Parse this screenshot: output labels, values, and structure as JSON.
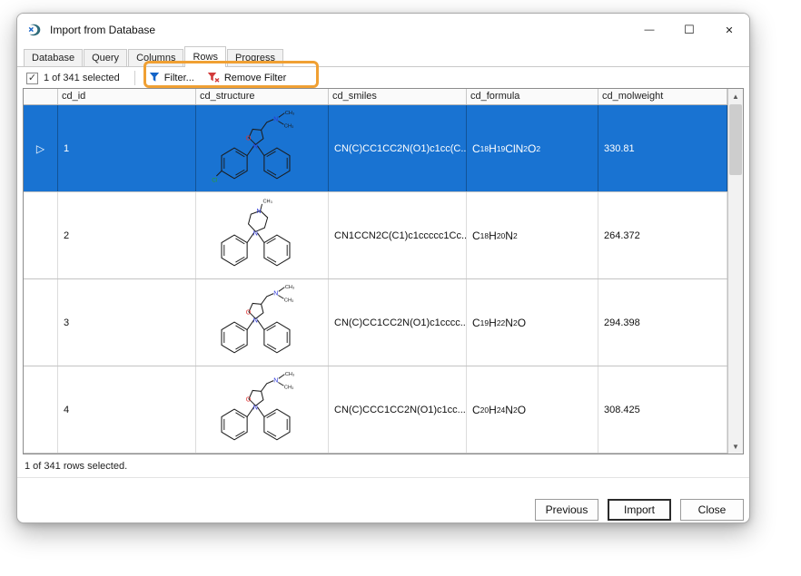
{
  "window": {
    "title": "Import from Database",
    "controls": [
      {
        "name": "minimize",
        "glyph": "—"
      },
      {
        "name": "maximize",
        "glyph": "☐"
      },
      {
        "name": "close",
        "glyph": "✕"
      }
    ]
  },
  "tabs": [
    {
      "label": "Database",
      "active": false
    },
    {
      "label": "Query",
      "active": false
    },
    {
      "label": "Columns",
      "active": false
    },
    {
      "label": "Rows",
      "active": true
    },
    {
      "label": "Progress",
      "active": false
    }
  ],
  "toolbar": {
    "check_glyph": "✓",
    "checkbox_checked": true,
    "selection_label": "1 of 341 selected",
    "filter_label": "Filter...",
    "remove_filter_label": "Remove Filter"
  },
  "annotation": {
    "color": "#f0a033",
    "highlights": "filter buttons"
  },
  "grid": {
    "columns": [
      "cd_id",
      "cd_structure",
      "cd_smiles",
      "cd_formula",
      "cd_molweight"
    ],
    "row_marker": "▷",
    "rows": [
      {
        "cd_id": "1",
        "structure_icon": "molecule-structure",
        "cd_smiles": "CN(C)CC1CC2N(O1)c1cc(C...",
        "cd_formula": "C18H19ClN2O2",
        "cd_molweight": "330.81",
        "selected": true
      },
      {
        "cd_id": "2",
        "structure_icon": "molecule-structure",
        "cd_smiles": "CN1CCN2C(C1)c1ccccc1Cc...",
        "cd_formula": "C18H20N2",
        "cd_molweight": "264.372",
        "selected": false
      },
      {
        "cd_id": "3",
        "structure_icon": "molecule-structure",
        "cd_smiles": "CN(C)CC1CC2N(O1)c1cccc...",
        "cd_formula": "C19H22N2O",
        "cd_molweight": "294.398",
        "selected": false
      },
      {
        "cd_id": "4",
        "structure_icon": "molecule-structure",
        "cd_smiles": "CN(C)CCC1CC2N(O1)c1cc...",
        "cd_formula": "C20H24N2O",
        "cd_molweight": "308.425",
        "selected": false
      }
    ],
    "scrollbar": {
      "up_glyph": "▲",
      "down_glyph": "▼"
    }
  },
  "status_bar": {
    "text": "1 of 341 rows selected."
  },
  "footer": {
    "previous": "Previous",
    "import": "Import",
    "close": "Close"
  },
  "colors": {
    "selection_blue": "#1973d2",
    "annotation_orange": "#f0a033",
    "filter_blue": "#1464c8",
    "remove_filter_red": "#d23b3b",
    "atom_nitrogen_blue": "#2b36d9",
    "atom_oxygen_red": "#e03131",
    "atom_chlorine_green": "#2aa02a"
  }
}
